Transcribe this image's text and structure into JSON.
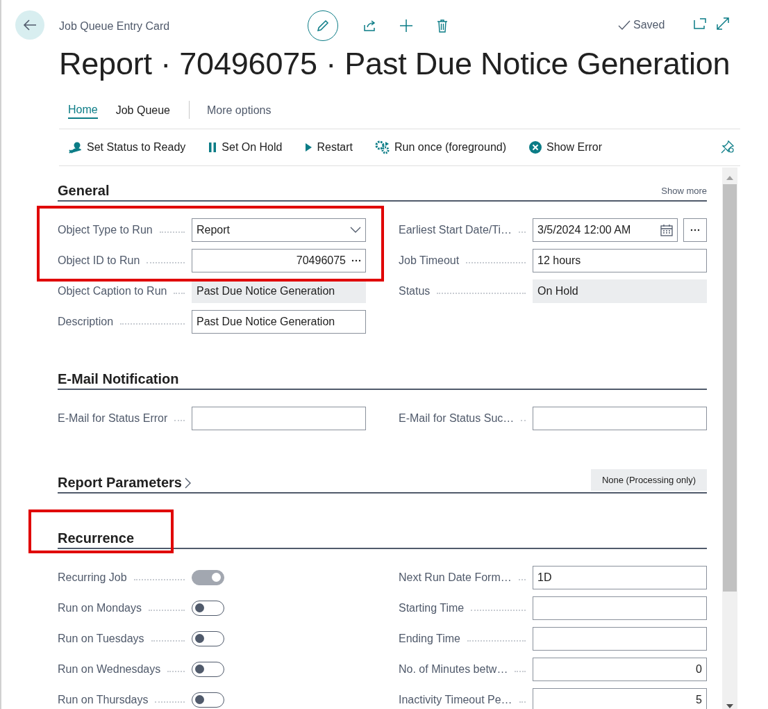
{
  "header": {
    "breadcrumb": "Job Queue Entry Card",
    "saved": "Saved",
    "title": "Report · 70496075 · Past Due Notice Generation"
  },
  "tabs": [
    {
      "label": "Home",
      "selected": true
    },
    {
      "label": "Job Queue",
      "selected": false
    },
    {
      "label": "More options",
      "selected": false
    }
  ],
  "actions": [
    {
      "label": "Set Status to Ready",
      "kind": "ready"
    },
    {
      "label": "Set On Hold",
      "kind": "pause"
    },
    {
      "label": "Restart",
      "kind": "play"
    },
    {
      "label": "Run once (foreground)",
      "kind": "run"
    },
    {
      "label": "Show Error",
      "kind": "error"
    }
  ],
  "sections": [
    {
      "title": "General",
      "link": "Show more",
      "left": [
        {
          "label": "Object Type to Run",
          "kind": "select",
          "value": "Report",
          "highlighted": true
        },
        {
          "label": "Object ID to Run",
          "kind": "lookup",
          "value": "70496075",
          "highlighted": true
        },
        {
          "label": "Object Caption to Run",
          "kind": "readonly",
          "value": "Past Due Notice Generation"
        },
        {
          "label": "Description",
          "kind": "text",
          "value": "Past Due Notice Generation"
        }
      ],
      "right": [
        {
          "label": "Earliest Start Date/Ti…",
          "kind": "date",
          "value": "3/5/2024 12:00 AM"
        },
        {
          "label": "Job Timeout",
          "kind": "text",
          "value": "12 hours"
        },
        {
          "label": "Status",
          "kind": "readonly",
          "value": "On Hold"
        }
      ]
    },
    {
      "title": "E-Mail Notification",
      "left": [
        {
          "label": "E-Mail for Status Error",
          "kind": "text"
        }
      ],
      "right": [
        {
          "label": "E-Mail for Status Suc…",
          "kind": "text"
        }
      ]
    },
    {
      "title": "Report Parameters",
      "badge": "None (Processing only)"
    },
    {
      "title": "Recurrence",
      "highlighted": true,
      "left": [
        {
          "label": "Recurring Job",
          "kind": "toggle",
          "on": true,
          "disabled": true
        },
        {
          "label": "Run on Mondays",
          "kind": "toggle",
          "on": false,
          "disabled": false
        },
        {
          "label": "Run on Tuesdays",
          "kind": "toggle",
          "on": false,
          "disabled": false
        },
        {
          "label": "Run on Wednesdays",
          "kind": "toggle",
          "on": false,
          "disabled": false
        },
        {
          "label": "Run on Thursdays",
          "kind": "toggle",
          "on": false,
          "disabled": false
        }
      ],
      "right": [
        {
          "label": "Next Run Date Form…",
          "kind": "text",
          "value": "1D"
        },
        {
          "label": "Starting Time",
          "kind": "text"
        },
        {
          "label": "Ending Time",
          "kind": "text"
        },
        {
          "label": "No. of Minutes betw…",
          "kind": "number",
          "value": "0"
        },
        {
          "label": "Inactivity Timeout Pe…",
          "kind": "number",
          "value": "5"
        }
      ]
    }
  ]
}
